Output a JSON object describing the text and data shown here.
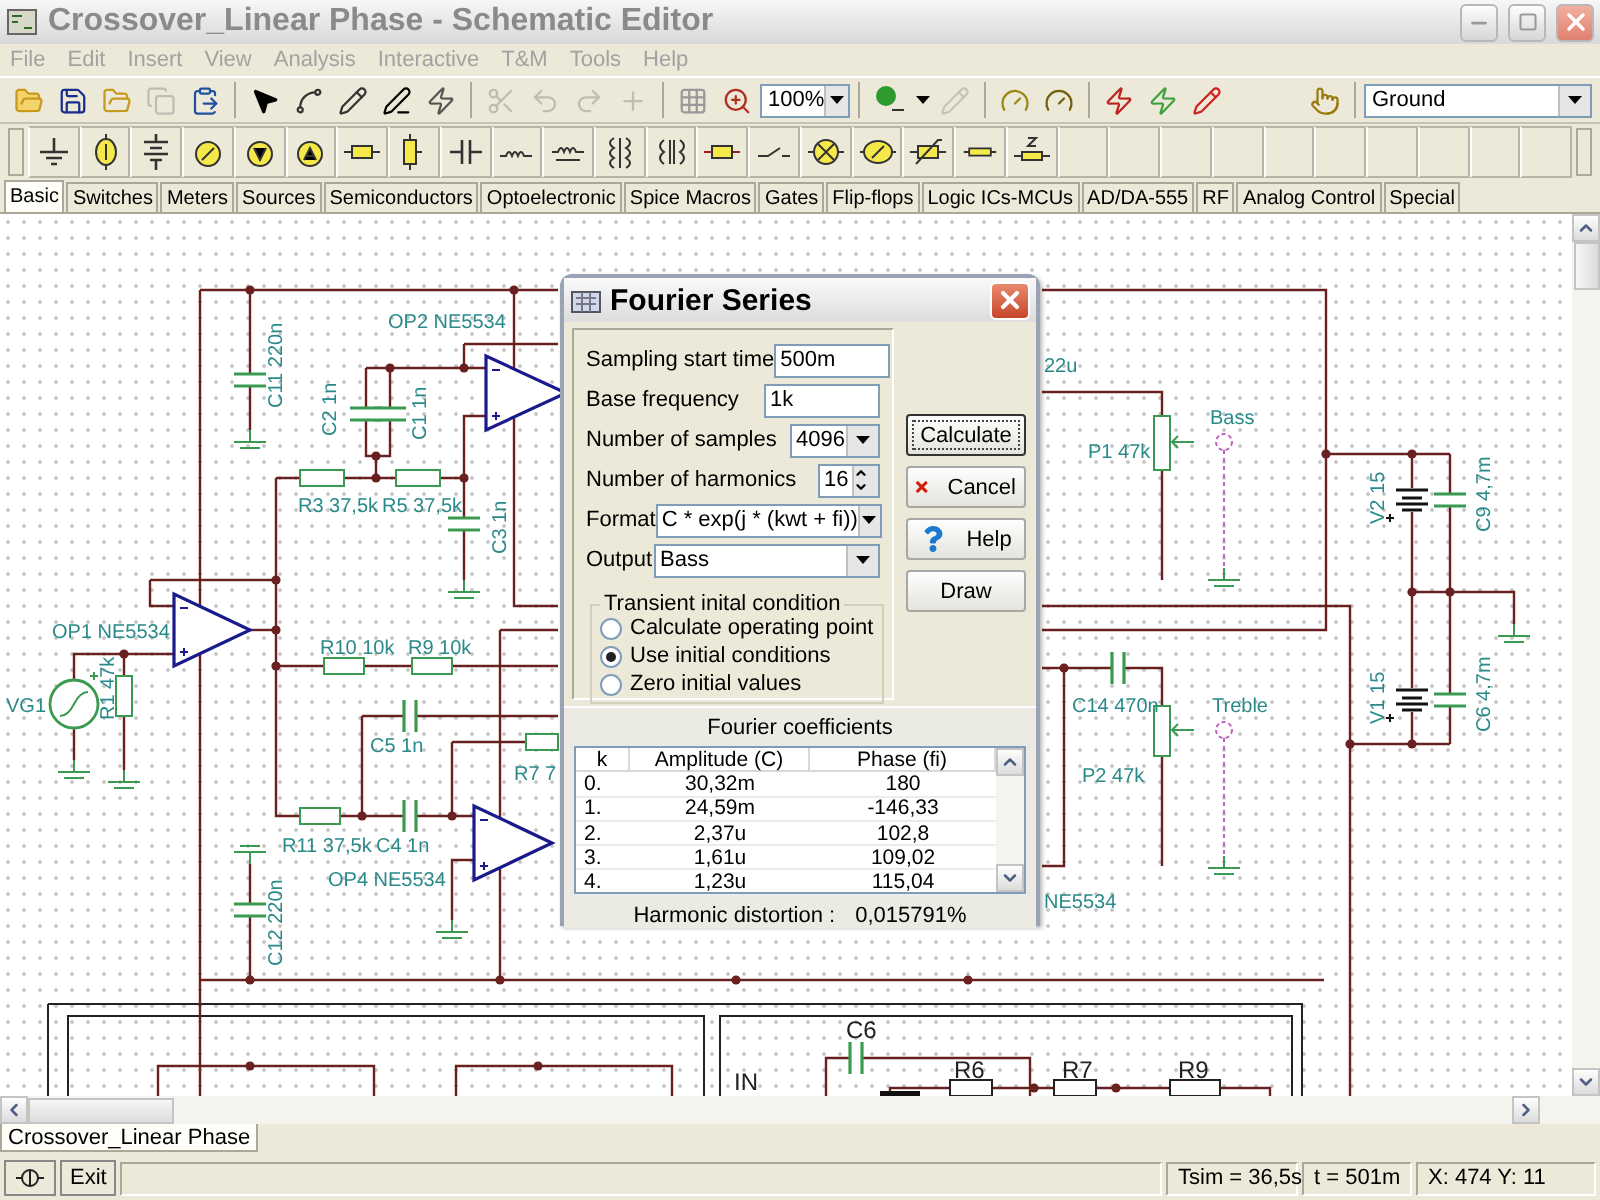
{
  "window": {
    "title": "Crossover_Linear Phase - Schematic Editor"
  },
  "menu": [
    "File",
    "Edit",
    "Insert",
    "View",
    "Analysis",
    "Interactive",
    "T&M",
    "Tools",
    "Help"
  ],
  "toolbar": {
    "zoom": "100%",
    "component_select": "Ground"
  },
  "component_tabs": [
    {
      "label": "Basic",
      "selected": true
    },
    {
      "label": "Switches",
      "selected": false
    },
    {
      "label": "Meters",
      "selected": false
    },
    {
      "label": "Sources",
      "selected": false
    },
    {
      "label": "Semiconductors",
      "selected": false
    },
    {
      "label": "Optoelectronic",
      "selected": false
    },
    {
      "label": "Spice Macros",
      "selected": false
    },
    {
      "label": "Gates",
      "selected": false
    },
    {
      "label": "Flip-flops",
      "selected": false
    },
    {
      "label": "Logic ICs-MCUs",
      "selected": false
    },
    {
      "label": "AD/DA-555",
      "selected": false
    },
    {
      "label": "RF",
      "selected": false
    },
    {
      "label": "Analog Control",
      "selected": false
    },
    {
      "label": "Special",
      "selected": false
    }
  ],
  "schematic": {
    "labels": [
      {
        "text": "OP2 NE5534",
        "kind": "component"
      },
      {
        "text": "C11 220n",
        "kind": "component"
      },
      {
        "text": "C2 1n",
        "kind": "component"
      },
      {
        "text": "C1 1n",
        "kind": "component"
      },
      {
        "text": "R3 37,5k",
        "kind": "component"
      },
      {
        "text": "R5 37,5k",
        "kind": "component"
      },
      {
        "text": "C3 1n",
        "kind": "component"
      },
      {
        "text": "OP1 NE5534",
        "kind": "component"
      },
      {
        "text": "R10 10k",
        "kind": "component"
      },
      {
        "text": "R9 10k",
        "kind": "component"
      },
      {
        "text": "VG1",
        "kind": "component"
      },
      {
        "text": "R1 47k",
        "kind": "component"
      },
      {
        "text": "C5 1n",
        "kind": "component"
      },
      {
        "text": "R7 7",
        "kind": "component"
      },
      {
        "text": "R11 37,5k",
        "kind": "component"
      },
      {
        "text": "C4 1n",
        "kind": "component"
      },
      {
        "text": "OP4 NE5534",
        "kind": "component"
      },
      {
        "text": "C12 220n",
        "kind": "component"
      },
      {
        "text": "22u",
        "kind": "component"
      },
      {
        "text": "Bass",
        "kind": "component"
      },
      {
        "text": "P1 47k",
        "kind": "component"
      },
      {
        "text": "V2 15",
        "kind": "component"
      },
      {
        "text": "C9 4,7m",
        "kind": "component"
      },
      {
        "text": "C14 470n",
        "kind": "component"
      },
      {
        "text": "Treble",
        "kind": "component"
      },
      {
        "text": "V1 15",
        "kind": "component"
      },
      {
        "text": "C6 4,7m",
        "kind": "component"
      },
      {
        "text": "P2 47k",
        "kind": "component"
      },
      {
        "text": "NE5534",
        "kind": "component"
      },
      {
        "text": "C6",
        "kind": "block"
      },
      {
        "text": "IN",
        "kind": "block"
      },
      {
        "text": "R6",
        "kind": "block"
      },
      {
        "text": "R7",
        "kind": "block"
      },
      {
        "text": "R9",
        "kind": "block"
      }
    ]
  },
  "dialog": {
    "title": "Fourier Series",
    "fields": [
      {
        "kind": "text",
        "label": "Sampling start time",
        "value": "500m"
      },
      {
        "kind": "text",
        "label": "Base frequency",
        "value": "1k"
      },
      {
        "kind": "select",
        "label": "Number of samples",
        "value": "4096"
      },
      {
        "kind": "spin",
        "label": "Number of harmonics",
        "value": "16"
      },
      {
        "kind": "wide-select",
        "label": "Format",
        "value": "C * exp(j * (kwt + fi))"
      },
      {
        "kind": "wide-select",
        "label": "Output",
        "value": "Bass"
      }
    ],
    "buttons": [
      {
        "kind": "default",
        "label": "Calculate"
      },
      {
        "kind": "cancel",
        "label": "Cancel"
      },
      {
        "kind": "help",
        "label": "Help"
      },
      {
        "kind": "plain",
        "label": "Draw"
      }
    ],
    "transient": {
      "title": "Transient inital condition",
      "options": [
        {
          "label": "Calculate operating point",
          "selected": false
        },
        {
          "label": "Use initial conditions",
          "selected": true
        },
        {
          "label": "Zero initial values",
          "selected": false
        }
      ]
    },
    "coefficients": {
      "title": "Fourier coefficients",
      "columns": [
        "k",
        "Amplitude (C)",
        "Phase (fi)"
      ],
      "rows": [
        [
          "0.",
          "30,32m",
          "180"
        ],
        [
          "1.",
          "24,59m",
          "-146,33"
        ],
        [
          "2.",
          "2,37u",
          "102,8"
        ],
        [
          "3.",
          "1,61u",
          "109,02"
        ],
        [
          "4.",
          "1,23u",
          "115,04"
        ]
      ]
    },
    "distortion": {
      "label": "Harmonic distortion :",
      "value": "0,015791%"
    }
  },
  "document_tab": "Crossover_Linear Phase",
  "status_bar": {
    "button": "Exit",
    "tsim": "Tsim = 36,5s",
    "t": "t = 501m",
    "coords": "X: 474  Y: 11"
  }
}
